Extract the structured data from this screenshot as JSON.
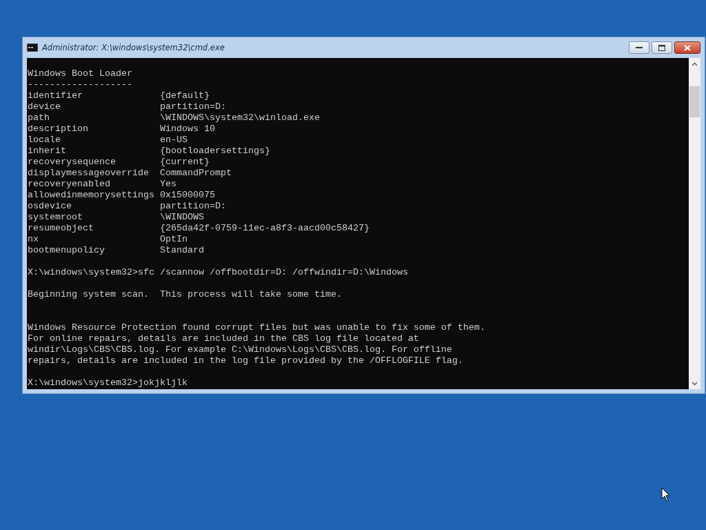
{
  "window": {
    "title": "Administrator: X:\\windows\\system32\\cmd.exe"
  },
  "console": {
    "lines": [
      {
        "kind": "text",
        "text": "Windows Boot Loader"
      },
      {
        "kind": "text",
        "text": "-------------------"
      },
      {
        "kind": "pair",
        "key": "identifier",
        "value": "{default}"
      },
      {
        "kind": "pair",
        "key": "device",
        "value": "partition=D:"
      },
      {
        "kind": "pair",
        "key": "path",
        "value": "\\WINDOWS\\system32\\winload.exe"
      },
      {
        "kind": "pair",
        "key": "description",
        "value": "Windows 10"
      },
      {
        "kind": "pair",
        "key": "locale",
        "value": "en-US"
      },
      {
        "kind": "pair",
        "key": "inherit",
        "value": "{bootloadersettings}"
      },
      {
        "kind": "pair",
        "key": "recoverysequence",
        "value": "{current}"
      },
      {
        "kind": "pair",
        "key": "displaymessageoverride",
        "value": "CommandPrompt"
      },
      {
        "kind": "pair",
        "key": "recoveryenabled",
        "value": "Yes"
      },
      {
        "kind": "pair",
        "key": "allowedinmemorysettings",
        "value": "0x15000075"
      },
      {
        "kind": "pair",
        "key": "osdevice",
        "value": "partition=D:"
      },
      {
        "kind": "pair",
        "key": "systemroot",
        "value": "\\WINDOWS"
      },
      {
        "kind": "pair",
        "key": "resumeobject",
        "value": "{265da42f-0759-11ec-a8f3-aacd00c58427}"
      },
      {
        "kind": "pair",
        "key": "nx",
        "value": "OptIn"
      },
      {
        "kind": "pair",
        "key": "bootmenupolicy",
        "value": "Standard"
      },
      {
        "kind": "blank"
      },
      {
        "kind": "text",
        "text": "X:\\windows\\system32>sfc /scannow /offbootdir=D: /offwindir=D:\\Windows"
      },
      {
        "kind": "blank"
      },
      {
        "kind": "text",
        "text": "Beginning system scan.  This process will take some time."
      },
      {
        "kind": "blank"
      },
      {
        "kind": "blank"
      },
      {
        "kind": "text",
        "text": "Windows Resource Protection found corrupt files but was unable to fix some of them."
      },
      {
        "kind": "text",
        "text": "For online repairs, details are included in the CBS log file located at"
      },
      {
        "kind": "text",
        "text": "windir\\Logs\\CBS\\CBS.log. For example C:\\Windows\\Logs\\CBS\\CBS.log. For offline"
      },
      {
        "kind": "text",
        "text": "repairs, details are included in the log file provided by the /OFFLOGFILE flag."
      },
      {
        "kind": "blank"
      },
      {
        "kind": "text",
        "text": "X:\\windows\\system32>jokjkljlk"
      }
    ]
  }
}
